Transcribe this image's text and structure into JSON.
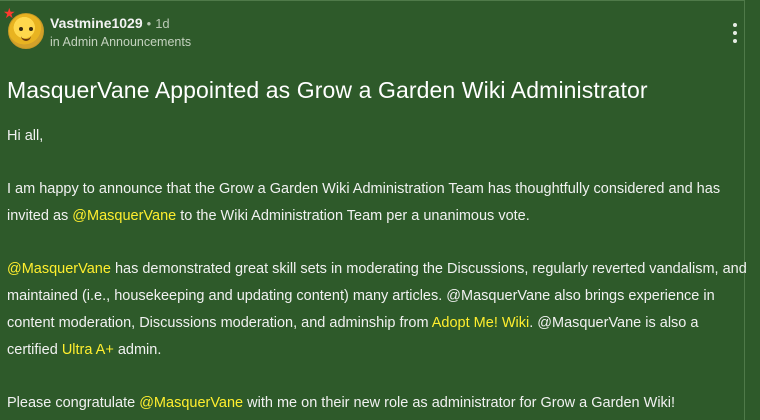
{
  "post": {
    "author": "Vastmine1029",
    "separator": "•",
    "age": "1d",
    "category_prefix": "in",
    "category": "Admin Announcements",
    "title": "MasquerVane Appointed as Grow a Garden Wiki Administrator"
  },
  "body": {
    "greeting": "Hi all,",
    "p1_a": "I am happy to announce that the Grow a Garden Wiki Administration Team has thoughtfully considered and has invited as ",
    "p1_mention": "@MasquerVane",
    "p1_b": " to the Wiki Administration Team per a unanimous vote.",
    "p2_mention": "@MasquerVane",
    "p2_a": "  has demonstrated great skill sets in moderating the Discussions, regularly reverted vandalism, and maintained (i.e., housekeeping and updating content) many articles. @MasquerVane also brings experience in content moderation, Discussions moderation, and adminship from ",
    "p2_link1": "Adopt Me! Wiki",
    "p2_b": ". @MasquerVane is also a certified ",
    "p2_link2": "Ultra A+",
    "p2_c": " admin.",
    "p3_a": "Please congratulate ",
    "p3_mention": "@MasquerVane",
    "p3_b": " with me on their new role as administrator for Grow a Garden Wiki!"
  },
  "colors": {
    "background": "#2e5a2a",
    "link": "#ffee2e",
    "badge": "#ff3a2e"
  },
  "icons": {
    "avatar": "avatar",
    "badge": "star-icon",
    "menu": "more-vertical-icon"
  }
}
